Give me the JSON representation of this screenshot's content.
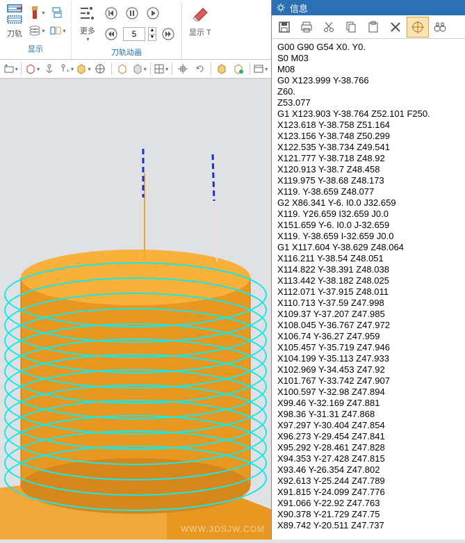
{
  "ribbon": {
    "group1_label": "显示",
    "group2_label": "刀轨动画",
    "btn_toolpath": "刀轨",
    "btn_more": "更多",
    "btn_display": "显示 T",
    "spin_value": "5"
  },
  "info": {
    "title": "信息",
    "tools": [
      "save",
      "print",
      "cut",
      "copy",
      "paste",
      "close",
      "crosshair",
      "binoculars"
    ]
  },
  "nc_lines": [
    "G00 G90 G54 X0. Y0.",
    "S0 M03",
    "M08",
    "G0 X123.999 Y-38.766",
    "Z60.",
    "Z53.077",
    "G1 X123.903 Y-38.764 Z52.101 F250.",
    "X123.618 Y-38.758 Z51.164",
    "X123.156 Y-38.748 Z50.299",
    "X122.535 Y-38.734 Z49.541",
    "X121.777 Y-38.718 Z48.92",
    "X120.913 Y-38.7 Z48.458",
    "X119.975 Y-38.68 Z48.173",
    "X119. Y-38.659 Z48.077",
    "G2 X86.341 Y-6. I0.0 J32.659",
    "X119. Y26.659 I32.659 J0.0",
    "X151.659 Y-6. I0.0 J-32.659",
    "X119. Y-38.659 I-32.659 J0.0",
    "G1 X117.604 Y-38.629 Z48.064",
    "X116.211 Y-38.54 Z48.051",
    "X114.822 Y-38.391 Z48.038",
    "X113.442 Y-38.182 Z48.025",
    "X112.071 Y-37.915 Z48.011",
    "X110.713 Y-37.59 Z47.998",
    "X109.37 Y-37.207 Z47.985",
    "X108.045 Y-36.767 Z47.972",
    "X106.74 Y-36.27 Z47.959",
    "X105.457 Y-35.719 Z47.946",
    "X104.199 Y-35.113 Z47.933",
    "X102.969 Y-34.453 Z47.92",
    "X101.767 Y-33.742 Z47.907",
    "X100.597 Y-32.98 Z47.894",
    "X99.46 Y-32.169 Z47.881",
    "X98.36 Y-31.31 Z47.868",
    "X97.297 Y-30.404 Z47.854",
    "X96.273 Y-29.454 Z47.841",
    "X95.292 Y-28.461 Z47.828",
    "X94.353 Y-27.428 Z47.815",
    "X93.46 Y-26.354 Z47.802",
    "X92.613 Y-25.244 Z47.789",
    "X91.815 Y-24.099 Z47.776",
    "X91.066 Y-22.92 Z47.763",
    "X90.378 Y-21.729 Z47.75",
    "X89.742 Y-20.511 Z47.737"
  ],
  "watermark": "WWW.3DSJW.COM"
}
